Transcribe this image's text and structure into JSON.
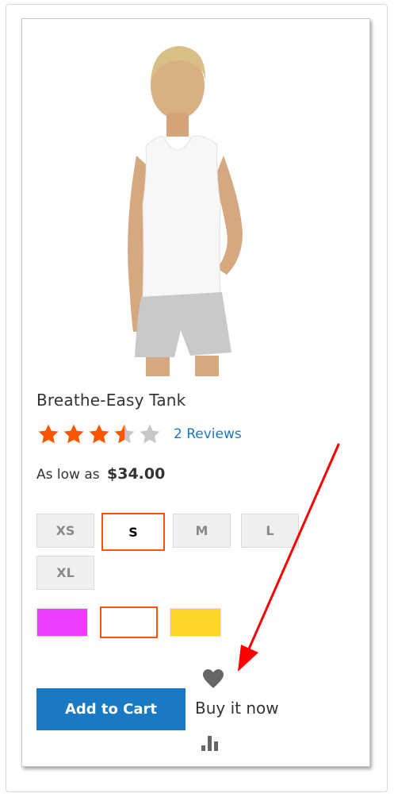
{
  "product": {
    "name": "Breathe-Easy Tank",
    "rating_stars": 3.5,
    "rating_max": 5,
    "reviews_label": "2 Reviews",
    "price_prefix": "As low as",
    "price": "$34.00"
  },
  "sizes": [
    {
      "label": "XS",
      "selected": false
    },
    {
      "label": "S",
      "selected": true
    },
    {
      "label": "M",
      "selected": false
    },
    {
      "label": "L",
      "selected": false
    },
    {
      "label": "XL",
      "selected": false
    }
  ],
  "colors": [
    {
      "value": "#ef3dff",
      "selected": false
    },
    {
      "value": "#ffffff",
      "selected": true
    },
    {
      "value": "#ffd528",
      "selected": false
    }
  ],
  "actions": {
    "add_to_cart": "Add to Cart",
    "buy_now": "Buy it now"
  },
  "icons": {
    "wishlist": "heart-icon",
    "compare": "compare-chart-icon"
  },
  "theme": {
    "primary": "#1979c3",
    "accent": "#ff5501",
    "star_on": "#ff5501",
    "star_off": "#c7c7c7",
    "annotation": "#ff0000"
  }
}
